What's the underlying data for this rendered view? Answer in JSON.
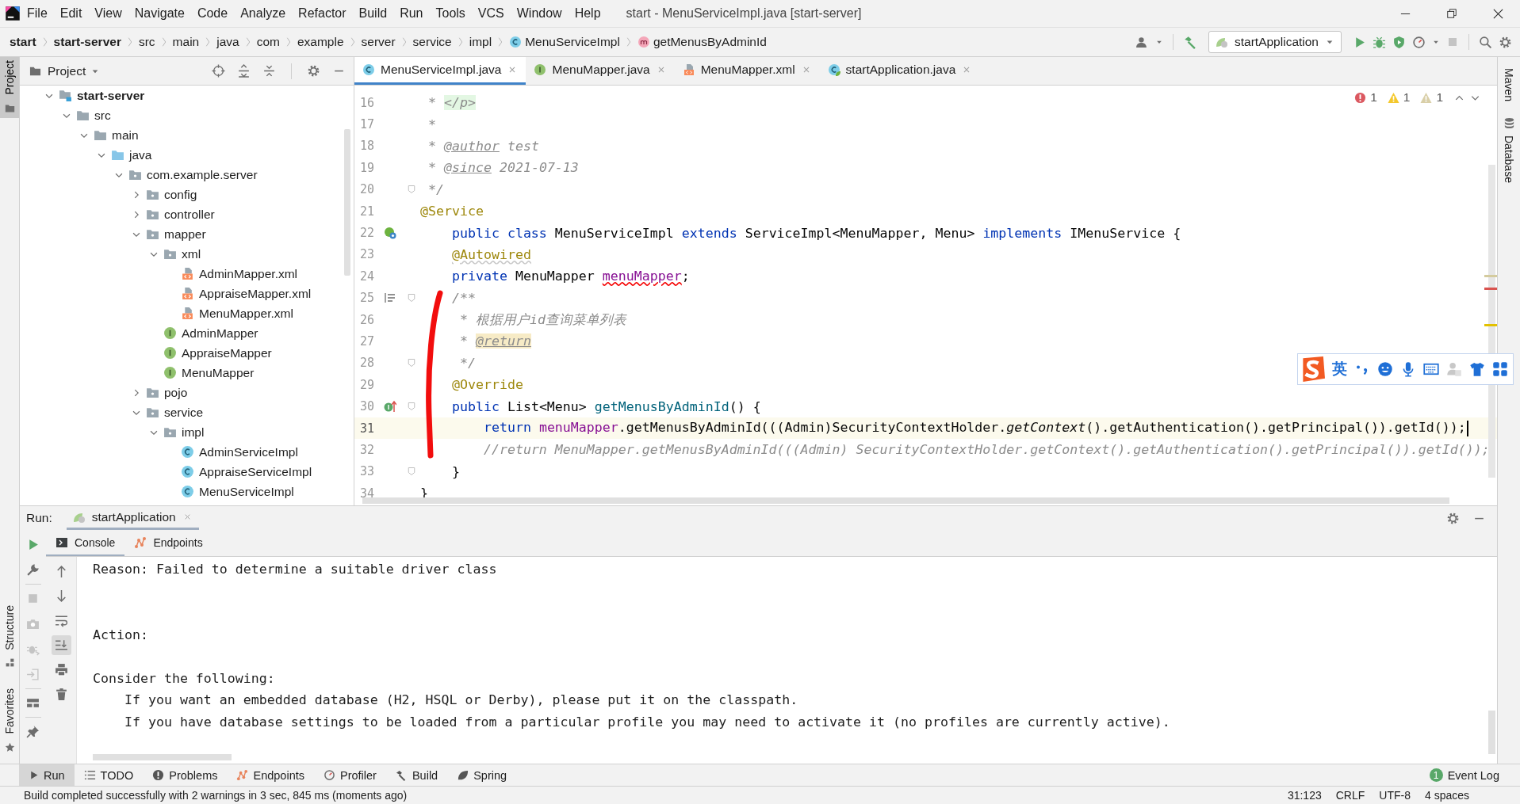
{
  "window": {
    "title": "start - MenuServiceImpl.java [start-server]"
  },
  "menu": [
    "File",
    "Edit",
    "View",
    "Navigate",
    "Code",
    "Analyze",
    "Refactor",
    "Build",
    "Run",
    "Tools",
    "VCS",
    "Window",
    "Help"
  ],
  "breadcrumb": [
    {
      "label": "start",
      "kind": "root"
    },
    {
      "label": "start-server",
      "kind": "root"
    },
    {
      "label": "src",
      "kind": "plain"
    },
    {
      "label": "main",
      "kind": "plain"
    },
    {
      "label": "java",
      "kind": "plain"
    },
    {
      "label": "com",
      "kind": "plain"
    },
    {
      "label": "example",
      "kind": "plain"
    },
    {
      "label": "server",
      "kind": "plain"
    },
    {
      "label": "service",
      "kind": "plain"
    },
    {
      "label": "impl",
      "kind": "plain"
    },
    {
      "label": "MenuServiceImpl",
      "kind": "class"
    },
    {
      "label": "getMenusByAdminId",
      "kind": "method"
    }
  ],
  "run_configuration": {
    "label": "startApplication"
  },
  "side_tabs_left": [
    {
      "label": "Project",
      "kind": "project",
      "selected": true
    },
    {
      "label": "Structure",
      "kind": "structure",
      "selected": false
    },
    {
      "label": "Favorites",
      "kind": "favorites",
      "selected": false
    }
  ],
  "side_tabs_right": [
    {
      "label": "Maven",
      "kind": "maven"
    },
    {
      "label": "Database",
      "kind": "database"
    }
  ],
  "project_panel": {
    "title": "Project",
    "tree": [
      {
        "label": "start-server",
        "kind": "module",
        "expanded": true,
        "children": [
          {
            "label": "src",
            "kind": "folder",
            "expanded": true,
            "children": [
              {
                "label": "main",
                "kind": "folder",
                "expanded": true,
                "children": [
                  {
                    "label": "java",
                    "kind": "source_folder",
                    "expanded": true,
                    "children": [
                      {
                        "label": "com.example.server",
                        "kind": "package",
                        "expanded": true,
                        "children": [
                          {
                            "label": "config",
                            "kind": "package",
                            "expanded": false
                          },
                          {
                            "label": "controller",
                            "kind": "package",
                            "expanded": false
                          },
                          {
                            "label": "mapper",
                            "kind": "package",
                            "expanded": true,
                            "children": [
                              {
                                "label": "xml",
                                "kind": "package",
                                "expanded": true,
                                "children": [
                                  {
                                    "label": "AdminMapper.xml",
                                    "kind": "xml"
                                  },
                                  {
                                    "label": "AppraiseMapper.xml",
                                    "kind": "xml"
                                  },
                                  {
                                    "label": "MenuMapper.xml",
                                    "kind": "xml"
                                  }
                                ]
                              },
                              {
                                "label": "AdminMapper",
                                "kind": "interface"
                              },
                              {
                                "label": "AppraiseMapper",
                                "kind": "interface"
                              },
                              {
                                "label": "MenuMapper",
                                "kind": "interface"
                              }
                            ]
                          },
                          {
                            "label": "pojo",
                            "kind": "package",
                            "expanded": false
                          },
                          {
                            "label": "service",
                            "kind": "package",
                            "expanded": true,
                            "children": [
                              {
                                "label": "impl",
                                "kind": "package",
                                "expanded": true,
                                "children": [
                                  {
                                    "label": "AdminServiceImpl",
                                    "kind": "class"
                                  },
                                  {
                                    "label": "AppraiseServiceImpl",
                                    "kind": "class"
                                  },
                                  {
                                    "label": "MenuServiceImpl",
                                    "kind": "class"
                                  }
                                ]
                              }
                            ]
                          }
                        ]
                      }
                    ]
                  }
                ]
              }
            ]
          }
        ]
      }
    ]
  },
  "editor_tabs": [
    {
      "label": "MenuServiceImpl.java",
      "kind": "class",
      "selected": true
    },
    {
      "label": "MenuMapper.java",
      "kind": "interface",
      "selected": false
    },
    {
      "label": "MenuMapper.xml",
      "kind": "xml",
      "selected": false
    },
    {
      "label": "startApplication.java",
      "kind": "spring_class",
      "selected": false
    }
  ],
  "inspections": {
    "errors": "1",
    "warnings": "1",
    "weak_warnings": "1"
  },
  "code_lines": [
    {
      "number": "16",
      "kind": "code",
      "current": false,
      "tokens": [
        {
          "kind": "comment",
          "text": " * "
        },
        {
          "kind": "html_tag",
          "text": "</p>"
        }
      ]
    },
    {
      "number": "17",
      "kind": "code",
      "current": false,
      "tokens": [
        {
          "kind": "comment",
          "text": " *"
        }
      ]
    },
    {
      "number": "18",
      "kind": "code",
      "current": false,
      "tokens": [
        {
          "kind": "comment",
          "text": " * "
        },
        {
          "kind": "doc_tag",
          "text": "@author"
        },
        {
          "kind": "comment",
          "text": " test"
        }
      ]
    },
    {
      "number": "19",
      "kind": "code",
      "current": false,
      "tokens": [
        {
          "kind": "comment",
          "text": " * "
        },
        {
          "kind": "doc_tag",
          "text": "@since"
        },
        {
          "kind": "comment",
          "text": " 2021-07-13"
        }
      ]
    },
    {
      "number": "20",
      "kind": "code",
      "current": false,
      "fold": true,
      "tokens": [
        {
          "kind": "comment",
          "text": " */"
        }
      ]
    },
    {
      "number": "21",
      "kind": "code",
      "current": false,
      "tokens": [
        {
          "kind": "annotation",
          "text": "@Service"
        }
      ]
    },
    {
      "number": "22",
      "kind": "bean_marker",
      "current": false,
      "tokens": [
        {
          "kind": "keyword",
          "text": "    public class"
        },
        {
          "kind": "plain",
          "text": " MenuServiceImpl "
        },
        {
          "kind": "keyword",
          "text": "extends"
        },
        {
          "kind": "plain",
          "text": " ServiceImpl<MenuMapper, Menu> "
        },
        {
          "kind": "keyword",
          "text": "implements"
        },
        {
          "kind": "plain",
          "text": " IMenuService {"
        }
      ]
    },
    {
      "number": "23",
      "kind": "code",
      "current": false,
      "tokens": [
        {
          "kind": "annotation_warning",
          "text": "    @Autowired"
        }
      ]
    },
    {
      "number": "24",
      "kind": "code",
      "current": false,
      "tokens": [
        {
          "kind": "keyword",
          "text": "    private"
        },
        {
          "kind": "plain",
          "text": " MenuMapper "
        },
        {
          "kind": "field_error",
          "text": "menuMapper"
        },
        {
          "kind": "plain",
          "text": ";"
        }
      ]
    },
    {
      "number": "25",
      "kind": "doc_marker",
      "current": false,
      "fold": true,
      "tokens": [
        {
          "kind": "comment",
          "text": "    /**"
        }
      ]
    },
    {
      "number": "26",
      "kind": "code",
      "current": false,
      "tokens": [
        {
          "kind": "comment",
          "text": "     * 根据用户id查询菜单列表"
        }
      ]
    },
    {
      "number": "27",
      "kind": "code",
      "current": false,
      "tokens": [
        {
          "kind": "comment",
          "text": "     * "
        },
        {
          "kind": "doc_tag_highlight",
          "text": "@return"
        }
      ]
    },
    {
      "number": "28",
      "kind": "code",
      "current": false,
      "fold": true,
      "tokens": [
        {
          "kind": "comment",
          "text": "     */"
        }
      ]
    },
    {
      "number": "29",
      "kind": "code",
      "current": false,
      "tokens": [
        {
          "kind": "annotation",
          "text": "    @Override"
        }
      ]
    },
    {
      "number": "30",
      "kind": "override_marker",
      "current": false,
      "fold": true,
      "tokens": [
        {
          "kind": "keyword",
          "text": "    public"
        },
        {
          "kind": "plain",
          "text": " List<Menu> "
        },
        {
          "kind": "method_decl",
          "text": "getMenusByAdminId"
        },
        {
          "kind": "plain",
          "text": "() {"
        }
      ]
    },
    {
      "number": "31",
      "kind": "code",
      "current": true,
      "tokens": [
        {
          "kind": "keyword",
          "text": "        return"
        },
        {
          "kind": "field",
          "text": " menuMapper"
        },
        {
          "kind": "plain",
          "text": ".getMenusByAdminId(((Admin)SecurityContextHolder."
        },
        {
          "kind": "italic",
          "text": "getContext"
        },
        {
          "kind": "plain",
          "text": "().getAuthentication().getPrincipal()).getId());"
        }
      ]
    },
    {
      "number": "32",
      "kind": "code",
      "current": false,
      "tokens": [
        {
          "kind": "comment",
          "text": "        //return MenuMapper.getMenusByAdminId(((Admin) SecurityContextHolder.getContext().getAuthentication().getPrincipal()).getId());"
        }
      ]
    },
    {
      "number": "33",
      "kind": "code",
      "current": false,
      "fold": true,
      "tokens": [
        {
          "kind": "plain",
          "text": "    }"
        }
      ]
    },
    {
      "number": "34",
      "kind": "code",
      "current": false,
      "tokens": [
        {
          "kind": "plain",
          "text": "}"
        }
      ]
    }
  ],
  "ime_toolbar": {
    "mode": "英"
  },
  "run_panel": {
    "label": "Run:",
    "tabs": [
      {
        "label": "startApplication",
        "selected": true
      }
    ],
    "console_tabs": [
      {
        "label": "Console",
        "kind": "console",
        "selected": true
      },
      {
        "label": "Endpoints",
        "kind": "endpoints",
        "selected": false
      }
    ],
    "console_lines": [
      {
        "kind": "text",
        "text": "Reason: Failed to determine a suitable driver class"
      },
      {
        "kind": "blank"
      },
      {
        "kind": "blank"
      },
      {
        "kind": "text",
        "text": "Action:"
      },
      {
        "kind": "blank"
      },
      {
        "kind": "text",
        "text": "Consider the following:"
      },
      {
        "kind": "text",
        "text": "    If you want an embedded database (H2, HSQL or Derby), please put it on the classpath."
      },
      {
        "kind": "text",
        "text": "    If you have database settings to be loaded from a particular profile you may need to activate it (no profiles are currently active)."
      }
    ]
  },
  "bottom_tabs": [
    {
      "label": "Run",
      "kind": "run",
      "selected": true
    },
    {
      "label": "TODO",
      "kind": "todo",
      "selected": false
    },
    {
      "label": "Problems",
      "kind": "problems",
      "selected": false
    },
    {
      "label": "Endpoints",
      "kind": "endpoints",
      "selected": false
    },
    {
      "label": "Profiler",
      "kind": "profiler",
      "selected": false
    },
    {
      "label": "Build",
      "kind": "build",
      "selected": false
    },
    {
      "label": "Spring",
      "kind": "spring",
      "selected": false
    }
  ],
  "event_log": {
    "label": "Event Log",
    "count": "1"
  },
  "status_bar": {
    "message": "Build completed successfully with 2 warnings in 3 sec, 845 ms (moments ago)",
    "position": "31:123",
    "line_separator": "CRLF",
    "encoding": "UTF-8",
    "indent": "4 spaces"
  }
}
